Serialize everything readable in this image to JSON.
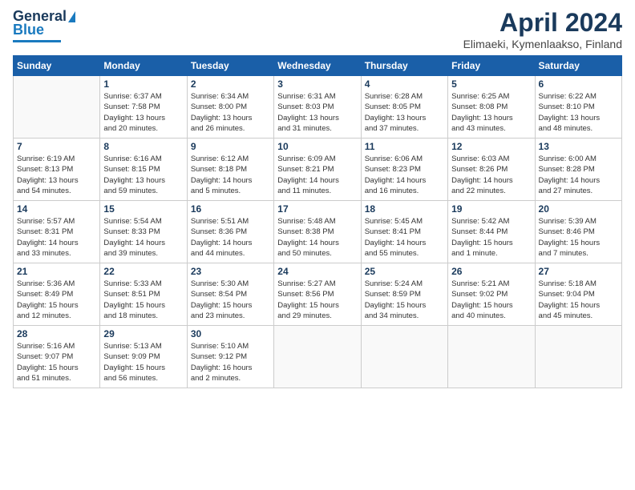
{
  "header": {
    "logo_general": "General",
    "logo_blue": "Blue",
    "month_year": "April 2024",
    "location": "Elimaeki, Kymenlaakso, Finland"
  },
  "weekdays": [
    "Sunday",
    "Monday",
    "Tuesday",
    "Wednesday",
    "Thursday",
    "Friday",
    "Saturday"
  ],
  "weeks": [
    [
      {
        "day": "",
        "info": ""
      },
      {
        "day": "1",
        "info": "Sunrise: 6:37 AM\nSunset: 7:58 PM\nDaylight: 13 hours\nand 20 minutes."
      },
      {
        "day": "2",
        "info": "Sunrise: 6:34 AM\nSunset: 8:00 PM\nDaylight: 13 hours\nand 26 minutes."
      },
      {
        "day": "3",
        "info": "Sunrise: 6:31 AM\nSunset: 8:03 PM\nDaylight: 13 hours\nand 31 minutes."
      },
      {
        "day": "4",
        "info": "Sunrise: 6:28 AM\nSunset: 8:05 PM\nDaylight: 13 hours\nand 37 minutes."
      },
      {
        "day": "5",
        "info": "Sunrise: 6:25 AM\nSunset: 8:08 PM\nDaylight: 13 hours\nand 43 minutes."
      },
      {
        "day": "6",
        "info": "Sunrise: 6:22 AM\nSunset: 8:10 PM\nDaylight: 13 hours\nand 48 minutes."
      }
    ],
    [
      {
        "day": "7",
        "info": "Sunrise: 6:19 AM\nSunset: 8:13 PM\nDaylight: 13 hours\nand 54 minutes."
      },
      {
        "day": "8",
        "info": "Sunrise: 6:16 AM\nSunset: 8:15 PM\nDaylight: 13 hours\nand 59 minutes."
      },
      {
        "day": "9",
        "info": "Sunrise: 6:12 AM\nSunset: 8:18 PM\nDaylight: 14 hours\nand 5 minutes."
      },
      {
        "day": "10",
        "info": "Sunrise: 6:09 AM\nSunset: 8:21 PM\nDaylight: 14 hours\nand 11 minutes."
      },
      {
        "day": "11",
        "info": "Sunrise: 6:06 AM\nSunset: 8:23 PM\nDaylight: 14 hours\nand 16 minutes."
      },
      {
        "day": "12",
        "info": "Sunrise: 6:03 AM\nSunset: 8:26 PM\nDaylight: 14 hours\nand 22 minutes."
      },
      {
        "day": "13",
        "info": "Sunrise: 6:00 AM\nSunset: 8:28 PM\nDaylight: 14 hours\nand 27 minutes."
      }
    ],
    [
      {
        "day": "14",
        "info": "Sunrise: 5:57 AM\nSunset: 8:31 PM\nDaylight: 14 hours\nand 33 minutes."
      },
      {
        "day": "15",
        "info": "Sunrise: 5:54 AM\nSunset: 8:33 PM\nDaylight: 14 hours\nand 39 minutes."
      },
      {
        "day": "16",
        "info": "Sunrise: 5:51 AM\nSunset: 8:36 PM\nDaylight: 14 hours\nand 44 minutes."
      },
      {
        "day": "17",
        "info": "Sunrise: 5:48 AM\nSunset: 8:38 PM\nDaylight: 14 hours\nand 50 minutes."
      },
      {
        "day": "18",
        "info": "Sunrise: 5:45 AM\nSunset: 8:41 PM\nDaylight: 14 hours\nand 55 minutes."
      },
      {
        "day": "19",
        "info": "Sunrise: 5:42 AM\nSunset: 8:44 PM\nDaylight: 15 hours\nand 1 minute."
      },
      {
        "day": "20",
        "info": "Sunrise: 5:39 AM\nSunset: 8:46 PM\nDaylight: 15 hours\nand 7 minutes."
      }
    ],
    [
      {
        "day": "21",
        "info": "Sunrise: 5:36 AM\nSunset: 8:49 PM\nDaylight: 15 hours\nand 12 minutes."
      },
      {
        "day": "22",
        "info": "Sunrise: 5:33 AM\nSunset: 8:51 PM\nDaylight: 15 hours\nand 18 minutes."
      },
      {
        "day": "23",
        "info": "Sunrise: 5:30 AM\nSunset: 8:54 PM\nDaylight: 15 hours\nand 23 minutes."
      },
      {
        "day": "24",
        "info": "Sunrise: 5:27 AM\nSunset: 8:56 PM\nDaylight: 15 hours\nand 29 minutes."
      },
      {
        "day": "25",
        "info": "Sunrise: 5:24 AM\nSunset: 8:59 PM\nDaylight: 15 hours\nand 34 minutes."
      },
      {
        "day": "26",
        "info": "Sunrise: 5:21 AM\nSunset: 9:02 PM\nDaylight: 15 hours\nand 40 minutes."
      },
      {
        "day": "27",
        "info": "Sunrise: 5:18 AM\nSunset: 9:04 PM\nDaylight: 15 hours\nand 45 minutes."
      }
    ],
    [
      {
        "day": "28",
        "info": "Sunrise: 5:16 AM\nSunset: 9:07 PM\nDaylight: 15 hours\nand 51 minutes."
      },
      {
        "day": "29",
        "info": "Sunrise: 5:13 AM\nSunset: 9:09 PM\nDaylight: 15 hours\nand 56 minutes."
      },
      {
        "day": "30",
        "info": "Sunrise: 5:10 AM\nSunset: 9:12 PM\nDaylight: 16 hours\nand 2 minutes."
      },
      {
        "day": "",
        "info": ""
      },
      {
        "day": "",
        "info": ""
      },
      {
        "day": "",
        "info": ""
      },
      {
        "day": "",
        "info": ""
      }
    ]
  ]
}
